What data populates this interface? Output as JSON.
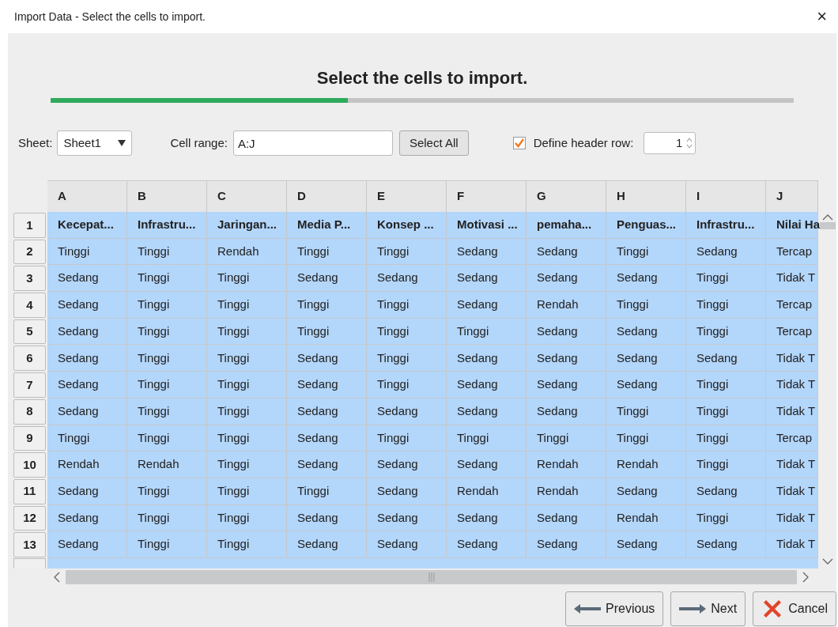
{
  "window": {
    "title": "Import Data - Select the cells to import.",
    "close": "×"
  },
  "heading": "Select the cells to import.",
  "progress": {
    "level": 0.4
  },
  "toolbar": {
    "sheet_label": "Sheet:",
    "sheet_value": "Sheet1",
    "range_label": "Cell range:",
    "range_value": "A:J",
    "select_all": "Select All",
    "header_label": "Define header row:",
    "header_checked": true,
    "header_row": "1"
  },
  "table": {
    "columns": [
      "A",
      "B",
      "C",
      "D",
      "E",
      "F",
      "G",
      "H",
      "I",
      "J"
    ],
    "rows": [
      {
        "number": "1",
        "header": true,
        "selected": true,
        "cells": [
          "Kecepat...",
          "Infrastru...",
          "Jaringan...",
          "Media P...",
          "Konsep ...",
          "Motivasi ...",
          "pemaha...",
          "Penguas...",
          "Infrastru...",
          "Nilai Ha"
        ]
      },
      {
        "number": "2",
        "header": false,
        "selected": true,
        "cells": [
          "Tinggi",
          "Tinggi",
          "Rendah",
          "Tinggi",
          "Tinggi",
          "Sedang",
          "Sedang",
          "Tinggi",
          "Sedang",
          "Tercap"
        ]
      },
      {
        "number": "3",
        "header": false,
        "selected": true,
        "cells": [
          "Sedang",
          "Tinggi",
          "Tinggi",
          "Sedang",
          "Sedang",
          "Sedang",
          "Sedang",
          "Sedang",
          "Tinggi",
          "Tidak T"
        ]
      },
      {
        "number": "4",
        "header": false,
        "selected": true,
        "cells": [
          "Sedang",
          "Tinggi",
          "Tinggi",
          "Tinggi",
          "Tinggi",
          "Sedang",
          "Rendah",
          "Tinggi",
          "Tinggi",
          "Tercap"
        ]
      },
      {
        "number": "5",
        "header": false,
        "selected": true,
        "cells": [
          "Sedang",
          "Tinggi",
          "Tinggi",
          "Tinggi",
          "Tinggi",
          "Tinggi",
          "Sedang",
          "Sedang",
          "Tinggi",
          "Tercap"
        ]
      },
      {
        "number": "6",
        "header": false,
        "selected": true,
        "cells": [
          "Sedang",
          "Tinggi",
          "Tinggi",
          "Sedang",
          "Tinggi",
          "Sedang",
          "Sedang",
          "Sedang",
          "Sedang",
          "Tidak T"
        ]
      },
      {
        "number": "7",
        "header": false,
        "selected": true,
        "cells": [
          "Sedang",
          "Tinggi",
          "Tinggi",
          "Sedang",
          "Tinggi",
          "Sedang",
          "Sedang",
          "Sedang",
          "Tinggi",
          "Tidak T"
        ]
      },
      {
        "number": "8",
        "header": false,
        "selected": true,
        "cells": [
          "Sedang",
          "Tinggi",
          "Tinggi",
          "Sedang",
          "Sedang",
          "Sedang",
          "Sedang",
          "Tinggi",
          "Tinggi",
          "Tidak T"
        ]
      },
      {
        "number": "9",
        "header": false,
        "selected": true,
        "cells": [
          "Tinggi",
          "Tinggi",
          "Tinggi",
          "Sedang",
          "Tinggi",
          "Tinggi",
          "Tinggi",
          "Tinggi",
          "Tinggi",
          "Tercap"
        ]
      },
      {
        "number": "10",
        "header": false,
        "selected": true,
        "cells": [
          "Rendah",
          "Rendah",
          "Tinggi",
          "Sedang",
          "Sedang",
          "Sedang",
          "Rendah",
          "Rendah",
          "Tinggi",
          "Tidak T"
        ]
      },
      {
        "number": "11",
        "header": false,
        "selected": true,
        "cells": [
          "Sedang",
          "Tinggi",
          "Tinggi",
          "Tinggi",
          "Sedang",
          "Rendah",
          "Rendah",
          "Sedang",
          "Sedang",
          "Tidak T"
        ]
      },
      {
        "number": "12",
        "header": false,
        "selected": true,
        "cells": [
          "Sedang",
          "Tinggi",
          "Tinggi",
          "Sedang",
          "Sedang",
          "Sedang",
          "Sedang",
          "Rendah",
          "Tinggi",
          "Tidak T"
        ]
      },
      {
        "number": "13",
        "header": false,
        "selected": true,
        "cells": [
          "Sedang",
          "Tinggi",
          "Tinggi",
          "Sedang",
          "Sedang",
          "Sedang",
          "Sedang",
          "Sedang",
          "Sedang",
          "Tidak T"
        ]
      }
    ]
  },
  "buttons": [
    {
      "kind": "previous",
      "label": "Previous"
    },
    {
      "kind": "next",
      "label": "Next"
    },
    {
      "kind": "cancel",
      "label": "Cancel"
    }
  ]
}
